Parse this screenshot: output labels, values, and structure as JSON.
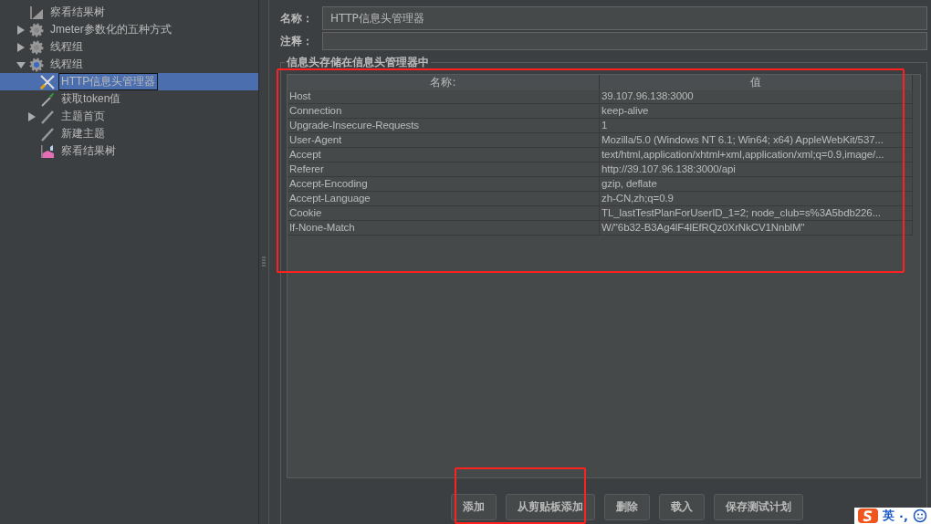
{
  "tree": [
    {
      "label": "察看结果树",
      "kind": "chart",
      "selected": false
    },
    {
      "label": "Jmeter参数化的五种方式",
      "kind": "gear",
      "selected": false,
      "expanded": false
    },
    {
      "label": "线程组",
      "kind": "gear",
      "selected": false,
      "expanded": false
    },
    {
      "label": "线程组",
      "kind": "gear-active",
      "selected": false,
      "expanded": true,
      "children": [
        {
          "label": "HTTP信息头管理器",
          "kind": "wrench",
          "selected": true
        },
        {
          "label": "获取token值",
          "kind": "dropper",
          "selected": false
        },
        {
          "label": "主题首页",
          "kind": "pen",
          "selected": false,
          "expanded": false
        },
        {
          "label": "新建主题",
          "kind": "pen",
          "selected": false
        },
        {
          "label": "察看结果树",
          "kind": "graph",
          "selected": false
        }
      ]
    }
  ],
  "form": {
    "name_label": "名称：",
    "name_value": "HTTP信息头管理器",
    "comment_label": "注释："
  },
  "group_title": "信息头存储在信息头管理器中",
  "table": {
    "columns": [
      "名称:",
      "值"
    ],
    "rows": [
      [
        "Host",
        "39.107.96.138:3000"
      ],
      [
        "Connection",
        "keep-alive"
      ],
      [
        "Upgrade-Insecure-Requests",
        "1"
      ],
      [
        "User-Agent",
        "Mozilla/5.0 (Windows NT 6.1; Win64; x64) AppleWebKit/537..."
      ],
      [
        "Accept",
        "text/html,application/xhtml+xml,application/xml;q=0.9,image/..."
      ],
      [
        "Referer",
        "http://39.107.96.138:3000/api"
      ],
      [
        "Accept-Encoding",
        "gzip, deflate"
      ],
      [
        "Accept-Language",
        "zh-CN,zh;q=0.9"
      ],
      [
        "Cookie",
        "TL_lastTestPlanForUserID_1=2; node_club=s%3A5bdb226..."
      ],
      [
        "If-None-Match",
        "W/\"6b32-B3Ag4lF4lEfRQz0XrNkCV1NnblM\""
      ]
    ]
  },
  "buttons": [
    "添加",
    "从剪贴板添加",
    "删除",
    "载入",
    "保存测试计划"
  ],
  "ime": {
    "language": "英",
    "punct": "·,"
  }
}
